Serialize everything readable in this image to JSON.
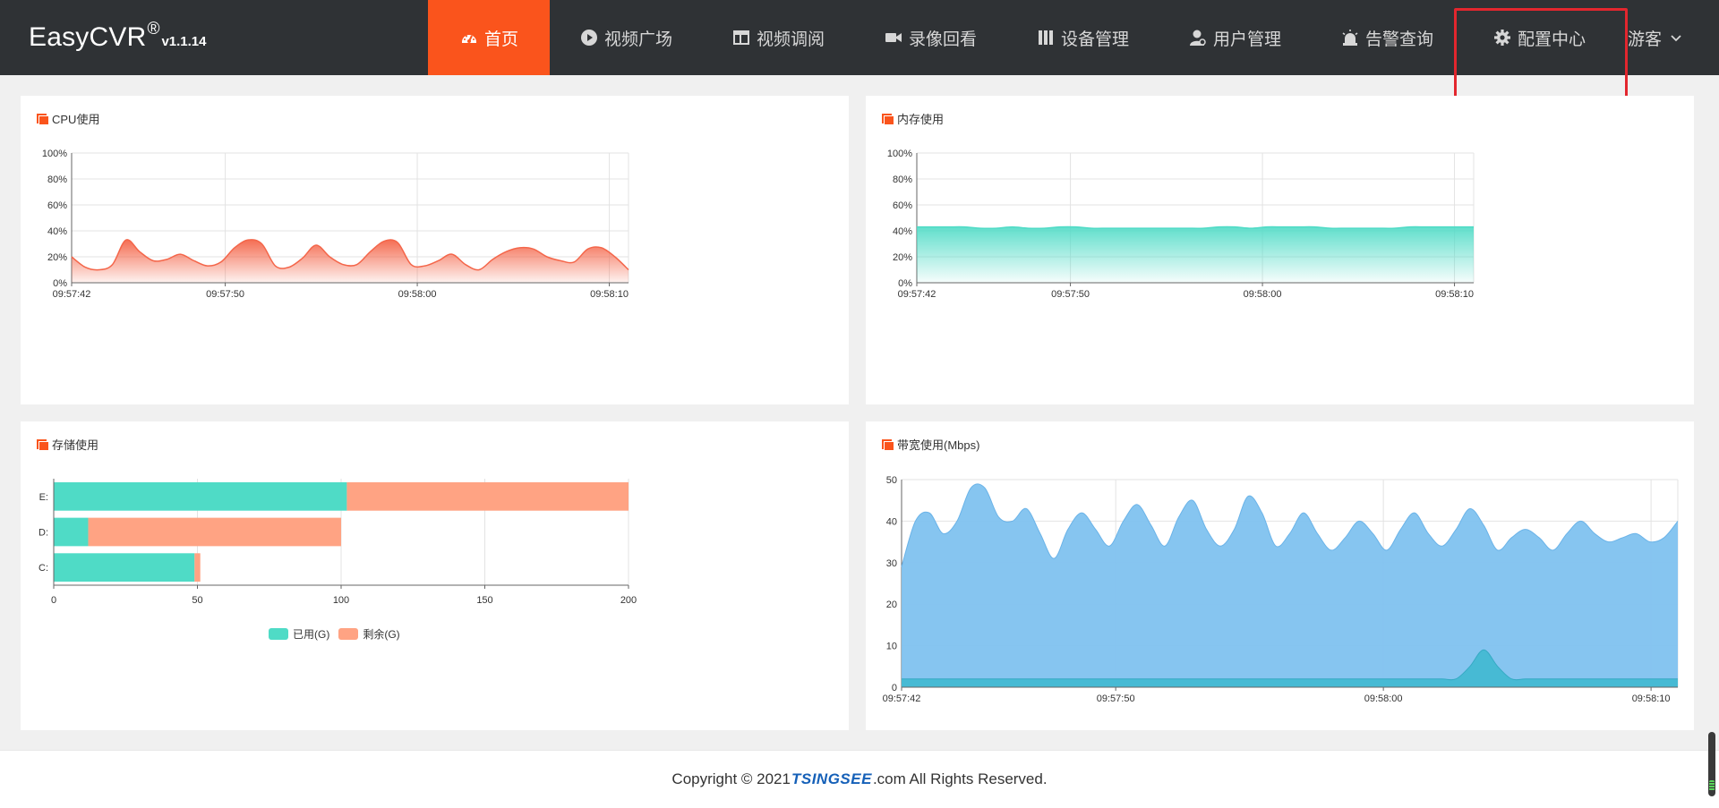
{
  "brand": {
    "name": "EasyCVR",
    "reg": "®",
    "version": "v1.1.14"
  },
  "nav": [
    {
      "label": "首页",
      "icon": "dashboard-icon",
      "active": true
    },
    {
      "label": "视频广场",
      "icon": "play-circle-icon",
      "active": false
    },
    {
      "label": "视频调阅",
      "icon": "layout-icon",
      "active": false
    },
    {
      "label": "录像回看",
      "icon": "video-camera-icon",
      "active": false
    },
    {
      "label": "设备管理",
      "icon": "device-icon",
      "active": false
    },
    {
      "label": "用户管理",
      "icon": "user-icon",
      "active": false
    },
    {
      "label": "告警查询",
      "icon": "alarm-icon",
      "active": false
    },
    {
      "label": "配置中心",
      "icon": "gear-icon",
      "active": false
    }
  ],
  "user_menu": {
    "label": "游客",
    "icon": "chevron-down-icon"
  },
  "colors": {
    "accent": "#fa541c",
    "topbar": "#2f3235",
    "cpu": "#f4664a",
    "memory": "#4fdbc6",
    "used": "#4fdbc6",
    "free": "#ffa383",
    "bandwidth": "#7fc2ef",
    "bandwidth_in": "#40b8d0"
  },
  "panels": {
    "cpu": {
      "title": "CPU使用"
    },
    "memory": {
      "title": "内存使用"
    },
    "storage": {
      "title": "存储使用"
    },
    "bandwidth": {
      "title": "带宽使用(Mbps)"
    }
  },
  "chart_data": [
    {
      "id": "cpu",
      "type": "area",
      "title": "CPU使用",
      "x_range_seconds": [
        0,
        29
      ],
      "x_tick_labels": [
        "09:57:42",
        "09:57:50",
        "09:58:00",
        "09:58:10"
      ],
      "x_ticks_seconds": [
        0,
        8,
        18,
        28
      ],
      "y_tick_labels": [
        "0%",
        "20%",
        "40%",
        "60%",
        "80%",
        "100%"
      ],
      "ylim": [
        0,
        100
      ],
      "grid": true,
      "series": [
        {
          "values": [
            20,
            12,
            10,
            14,
            33,
            24,
            17,
            18,
            22,
            17,
            13,
            16,
            27,
            33,
            30,
            13,
            12,
            19,
            29,
            20,
            14,
            14,
            24,
            32,
            31,
            14,
            13,
            17,
            22,
            14,
            10,
            18,
            24,
            27,
            26,
            20,
            17,
            16,
            26,
            27,
            20,
            10
          ]
        }
      ]
    },
    {
      "id": "memory",
      "type": "area",
      "title": "内存使用",
      "x_range_seconds": [
        0,
        29
      ],
      "x_tick_labels": [
        "09:57:42",
        "09:57:50",
        "09:58:00",
        "09:58:10"
      ],
      "x_ticks_seconds": [
        0,
        8,
        18,
        28
      ],
      "y_tick_labels": [
        "0%",
        "20%",
        "40%",
        "60%",
        "80%",
        "100%"
      ],
      "ylim": [
        0,
        100
      ],
      "grid": true,
      "series": [
        {
          "values": [
            43,
            43,
            43,
            43,
            42,
            42,
            43,
            42,
            42,
            43,
            43,
            42,
            42,
            42,
            42,
            42,
            42,
            42,
            42,
            43,
            43,
            42,
            43,
            43,
            43,
            43,
            42,
            42,
            42,
            42,
            42,
            43,
            43,
            43,
            43,
            43
          ]
        }
      ]
    },
    {
      "id": "storage",
      "type": "bar",
      "orientation": "horizontal",
      "stacked": true,
      "title": "存储使用",
      "categories": [
        "E:",
        "D:",
        "C:"
      ],
      "series": [
        {
          "name": "已用(G)",
          "values": [
            102,
            12,
            49
          ]
        },
        {
          "name": "剩余(G)",
          "values": [
            98,
            88,
            2
          ]
        }
      ],
      "xlim": [
        0,
        200
      ],
      "x_tick_labels": [
        "0",
        "50",
        "100",
        "150",
        "200"
      ],
      "legend": "bottom-center",
      "grid": true
    },
    {
      "id": "bandwidth",
      "type": "area",
      "title": "带宽使用(Mbps)",
      "x_range_seconds": [
        0,
        29
      ],
      "x_tick_labels": [
        "09:57:42",
        "09:57:50",
        "09:58:00",
        "09:58:10"
      ],
      "x_ticks_seconds": [
        0,
        8,
        18,
        28
      ],
      "y_tick_labels": [
        "0",
        "10",
        "20",
        "30",
        "40",
        "50"
      ],
      "ylim": [
        0,
        50
      ],
      "grid": true,
      "series": [
        {
          "values": [
            29,
            40,
            42,
            37,
            40,
            48,
            48,
            41,
            40,
            43,
            37,
            31,
            38,
            42,
            38,
            34,
            40,
            44,
            39,
            34,
            41,
            45,
            38,
            34,
            38,
            46,
            42,
            34,
            37,
            42,
            37,
            33,
            36,
            40,
            37,
            33,
            38,
            42,
            37,
            34,
            38,
            43,
            39,
            33,
            36,
            38,
            36,
            33,
            37,
            40,
            37,
            35,
            36,
            37,
            35,
            36,
            40
          ]
        },
        {
          "values": [
            2,
            2,
            2,
            2,
            2,
            2,
            2,
            2,
            2,
            2,
            2,
            2,
            2,
            2,
            2,
            2,
            2,
            2,
            2,
            2,
            2,
            2,
            2,
            2,
            2,
            2,
            2,
            2,
            2,
            2,
            2,
            2,
            2,
            2,
            2,
            2,
            2,
            2,
            2,
            2,
            2,
            5,
            9,
            5,
            2,
            2,
            2,
            2,
            2,
            2,
            2,
            2,
            2,
            2,
            2,
            2,
            2
          ]
        }
      ]
    }
  ],
  "footer": {
    "prefix": "Copyright © 2021 ",
    "brand": "TSINGSEE",
    "suffix": ".com All Rights Reserved."
  }
}
